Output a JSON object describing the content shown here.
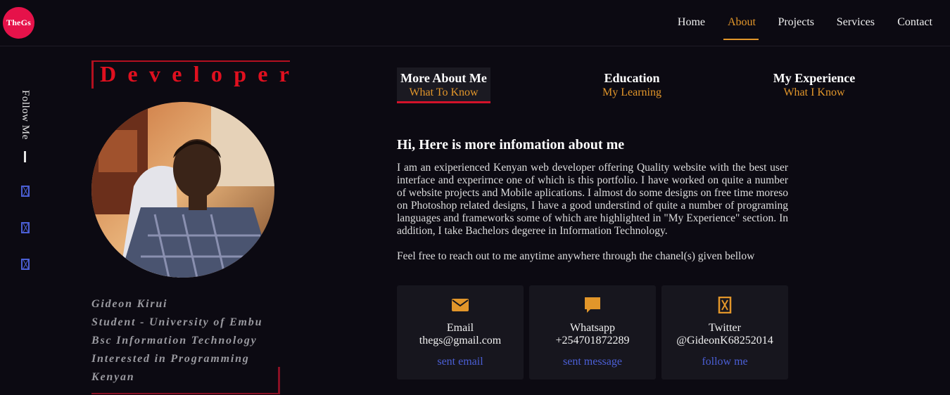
{
  "logo": {
    "text": "TheGs"
  },
  "nav": {
    "items": [
      {
        "label": "Home"
      },
      {
        "label": "About"
      },
      {
        "label": "Projects"
      },
      {
        "label": "Services"
      },
      {
        "label": "Contact"
      }
    ],
    "active": "About"
  },
  "follow": {
    "label": "Follow Me"
  },
  "profile": {
    "title": "Developer",
    "bio": [
      "Gideon Kirui",
      "Student - University of Embu",
      "Bsc Information Technology",
      "Interested in Programming",
      "Kenyan"
    ]
  },
  "tabs": [
    {
      "title": "More About Me",
      "subtitle": "What To Know"
    },
    {
      "title": "Education",
      "subtitle": "My Learning"
    },
    {
      "title": "My Experience",
      "subtitle": "What I Know"
    }
  ],
  "about": {
    "heading": "Hi, Here is more infomation about me",
    "paragraph": "I am an exiperienced Kenyan web developer offering Quality website with the best user interface and experirnce one of which is this portfolio. I have worked on quite a number of website projects and Mobile aplications. I almost do some designs on free time moreso on Photoshop related designs, I have a good understind of quite a number of programing languages and frameworks some of which are highlighted in \"My Experience\" section. In addition, I take Bachelors degeree in Information Technology.",
    "paragraph2": "Feel free to reach out to me anytime anywhere through the chanel(s) given bellow"
  },
  "contacts": [
    {
      "icon": "envelope-icon",
      "label": "Email",
      "value": "thegs@gmail.com",
      "link": "sent email"
    },
    {
      "icon": "chat-icon",
      "label": "Whatsapp",
      "value": "+254701872289",
      "link": "sent message"
    },
    {
      "icon": "twitter-icon",
      "label": "Twitter",
      "value": "@GideonK68252014",
      "link": "follow me"
    }
  ],
  "colors": {
    "accent": "#e2962a",
    "brand": "#e6124a",
    "link": "#4b5fd6",
    "title_red": "#e0101f"
  }
}
